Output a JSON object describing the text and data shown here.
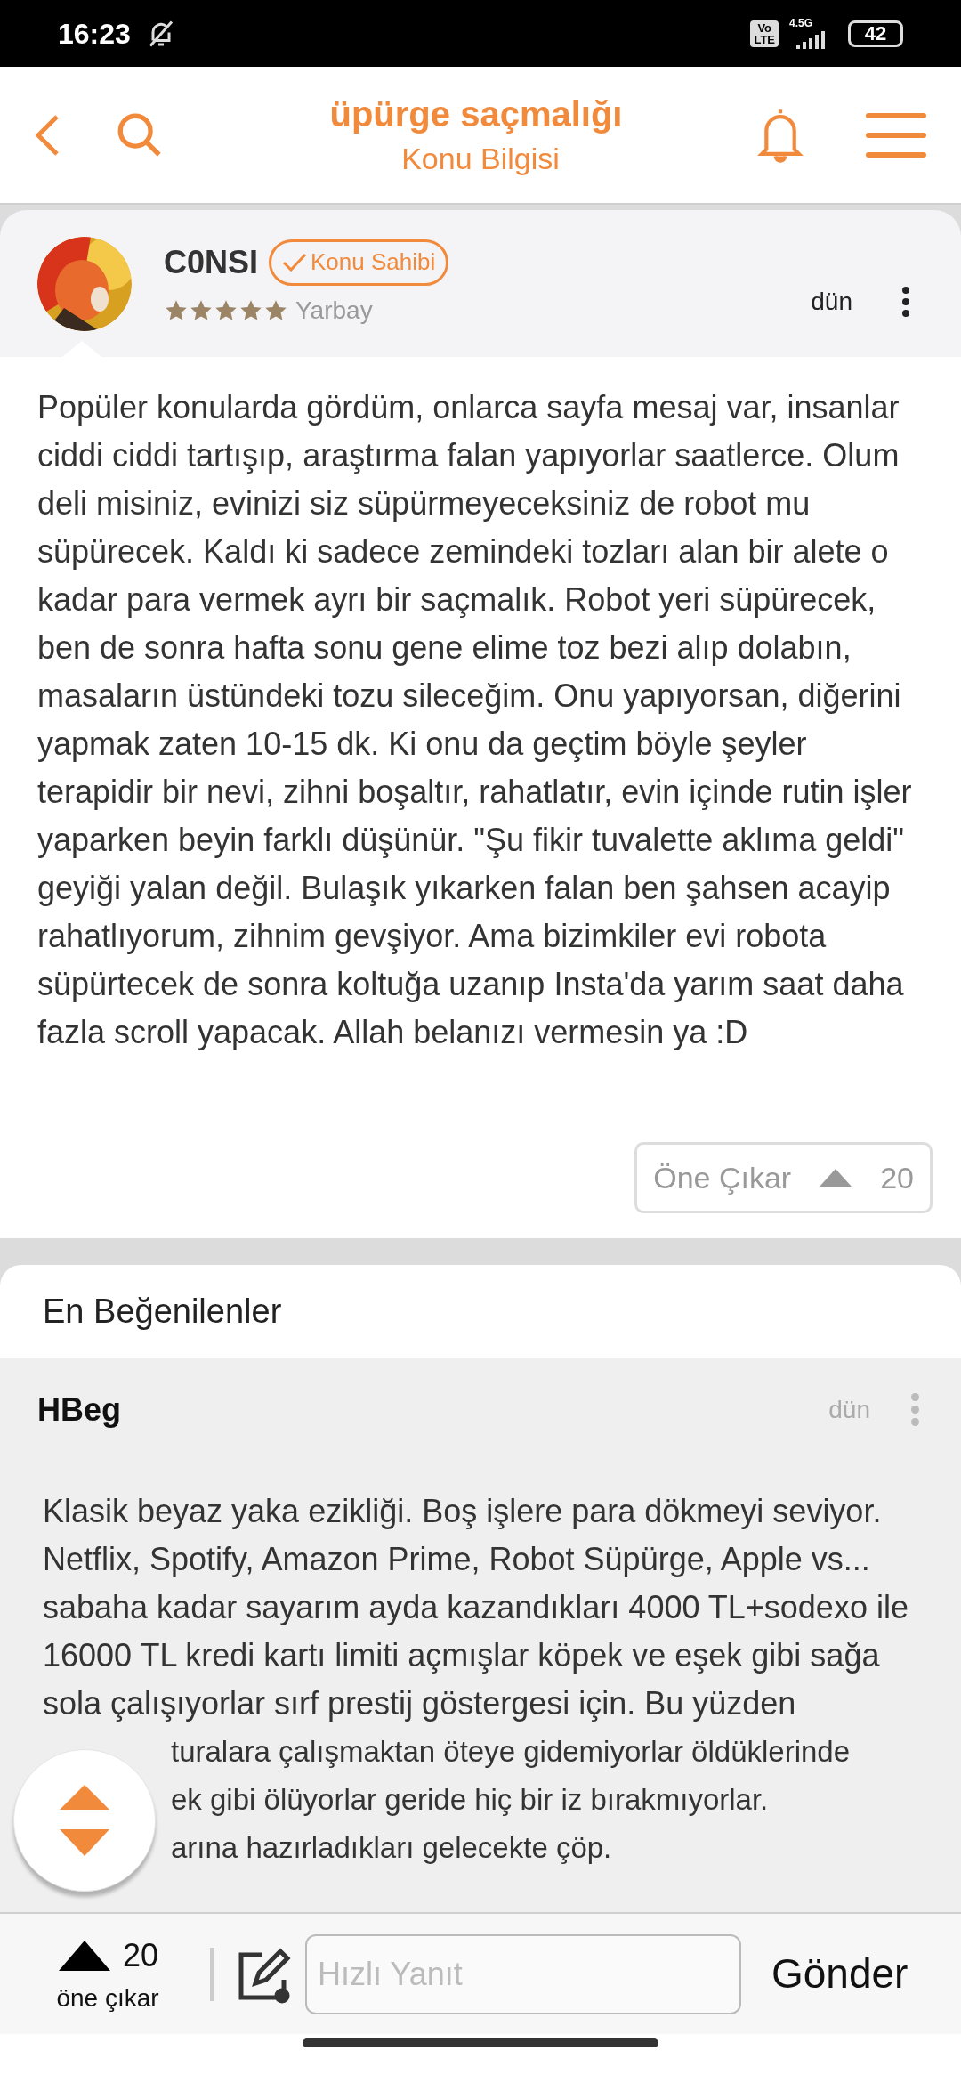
{
  "status_bar": {
    "time": "16:23",
    "volte_lines": [
      "Vo",
      "LTE"
    ],
    "network": "4.5G",
    "battery": "42"
  },
  "header": {
    "title": "üpürge saçmalığı",
    "subtitle": "Konu Bilgisi"
  },
  "post": {
    "author": "C0NSI",
    "badge": "Konu Sahibi",
    "stars": 5,
    "rank": "Yarbay",
    "time": "dün",
    "body": "Popüler konularda gördüm, onlarca sayfa mesaj var, insanlar ciddi ciddi tartışıp, araştırma falan yapıyorlar saatlerce. Olum deli misiniz, evinizi siz süpürmeyeceksiniz de robot mu süpürecek. Kaldı ki sadece zemindeki tozları alan bir alete o kadar para vermek ayrı bir saçmalık. Robot yeri süpürecek, ben de sonra hafta sonu gene elime toz bezi alıp dolabın, masaların üstündeki tozu sileceğim. Onu yapıyorsan, diğerini yapmak zaten 10-15 dk. Ki onu da geçtim böyle şeyler terapidir bir nevi, zihni boşaltır, rahatlatır, evin içinde rutin işler yaparken beyin farklı düşünür. \"Şu fikir tuvalette aklıma geldi\" geyiği yalan değil. Bulaşık yıkarken falan ben şahsen acayip rahatlıyorum, zihnim gevşiyor. Ama bizimkiler evi robota süpürtecek de sonra koltuğa uzanıp Insta'da yarım saat daha fazla scroll yapacak. Allah belanızı vermesin ya :D",
    "promote_label": "Öne Çıkar",
    "promote_count": "20"
  },
  "top_section": {
    "title": "En Beğenilenler",
    "author": "HBeg",
    "time": "dün",
    "body": "Klasik beyaz yaka ezikliği. Boş işlere para dökmeyi seviyor. Netflix, Spotify, Amazon Prime, Robot Süpürge, Apple vs... sabaha kadar sayarım ayda kazandıkları 4000 TL+sodexo ile 16000 TL kredi kartı limiti açmışlar köpek ve eşek gibi sağa sola çalışıyorlar sırf prestij göstergesi için. Bu yüzden",
    "covered_lines": [
      "turalara çalışmaktan öteye gidemiyorlar öldüklerinde",
      "ek gibi ölüyorlar geride hiç bir iz bırakmıyorlar.",
      "arına hazırladıkları gelecekte çöp."
    ]
  },
  "bottom_bar": {
    "count": "20",
    "promote_label": "öne çıkar",
    "reply_placeholder": "Hızlı Yanıt",
    "send": "Gönder"
  }
}
